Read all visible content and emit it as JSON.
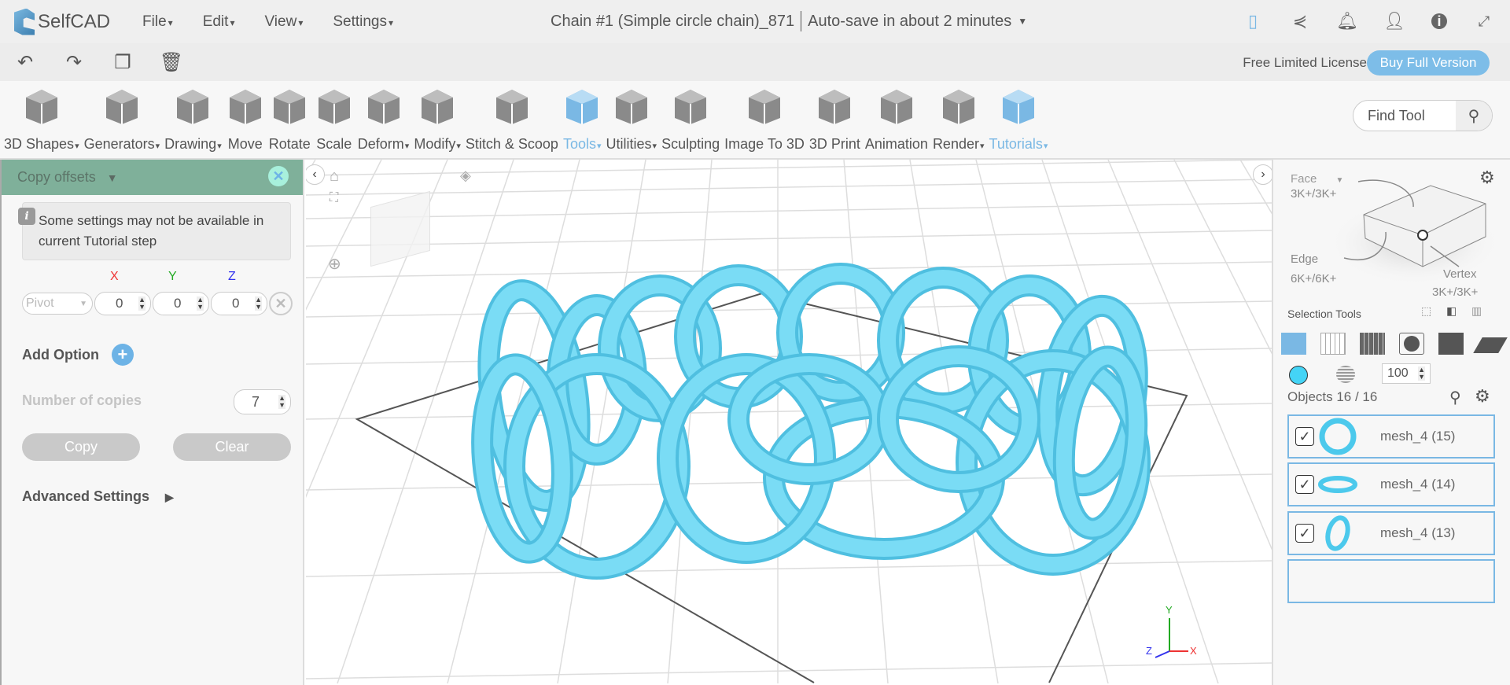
{
  "app": {
    "name": "SelfCAD"
  },
  "menu": [
    "File",
    "Edit",
    "View",
    "Settings"
  ],
  "title": {
    "project": "Chain #1 (Simple circle chain)_871",
    "autosave": "Auto-save in about 2 minutes"
  },
  "top_icons": [
    "save-icon",
    "share-icon",
    "bell-icon",
    "user-icon",
    "info-icon",
    "fullscreen-icon"
  ],
  "bar2": {
    "license": "Free Limited License",
    "buy": "Buy Full Version"
  },
  "toolbar": [
    {
      "label": "3D Shapes",
      "dropdown": true
    },
    {
      "label": "Generators",
      "dropdown": true
    },
    {
      "label": "Drawing",
      "dropdown": true
    },
    {
      "label": "Move"
    },
    {
      "label": "Rotate"
    },
    {
      "label": "Scale"
    },
    {
      "label": "Deform",
      "dropdown": true
    },
    {
      "label": "Modify",
      "dropdown": true
    },
    {
      "label": "Stitch & Scoop"
    },
    {
      "label": "Tools",
      "dropdown": true,
      "active": true
    },
    {
      "label": "Utilities",
      "dropdown": true
    },
    {
      "label": "Sculpting"
    },
    {
      "label": "Image To 3D"
    },
    {
      "label": "3D Print"
    },
    {
      "label": "Animation"
    },
    {
      "label": "Render",
      "dropdown": true
    },
    {
      "label": "Tutorials",
      "dropdown": true,
      "active": true
    }
  ],
  "find_tool": {
    "placeholder": "Find Tool"
  },
  "panel": {
    "title": "Copy offsets",
    "info": "Some settings may not be available in current Tutorial step",
    "axes": {
      "x": "X",
      "y": "Y",
      "z": "Z"
    },
    "pivot": "Pivot",
    "values": {
      "x": "0",
      "y": "0",
      "z": "0"
    },
    "add_option": "Add Option",
    "copies_label": "Number of copies",
    "copies": "7",
    "copy": "Copy",
    "clear": "Clear",
    "advanced": "Advanced Settings"
  },
  "right": {
    "face": "Face",
    "face_count": "3K+/3K+",
    "edge": "Edge",
    "edge_count": "6K+/6K+",
    "vertex": "Vertex",
    "vertex_count": "3K+/3K+",
    "selection_tools": "Selection Tools",
    "opacity": "100",
    "color": "#44d4f6",
    "objects_label": "Objects 16 / 16",
    "objects": [
      {
        "name": "mesh_4 (15)",
        "checked": true
      },
      {
        "name": "mesh_4 (14)",
        "checked": true
      },
      {
        "name": "mesh_4 (13)",
        "checked": true
      }
    ]
  },
  "axis_gizmo": {
    "x": "X",
    "y": "Y",
    "z": "Z"
  },
  "colors": {
    "accent": "#7ab8e4",
    "panel_header": "#7fb09a",
    "mesh": "#6fd8f2"
  }
}
